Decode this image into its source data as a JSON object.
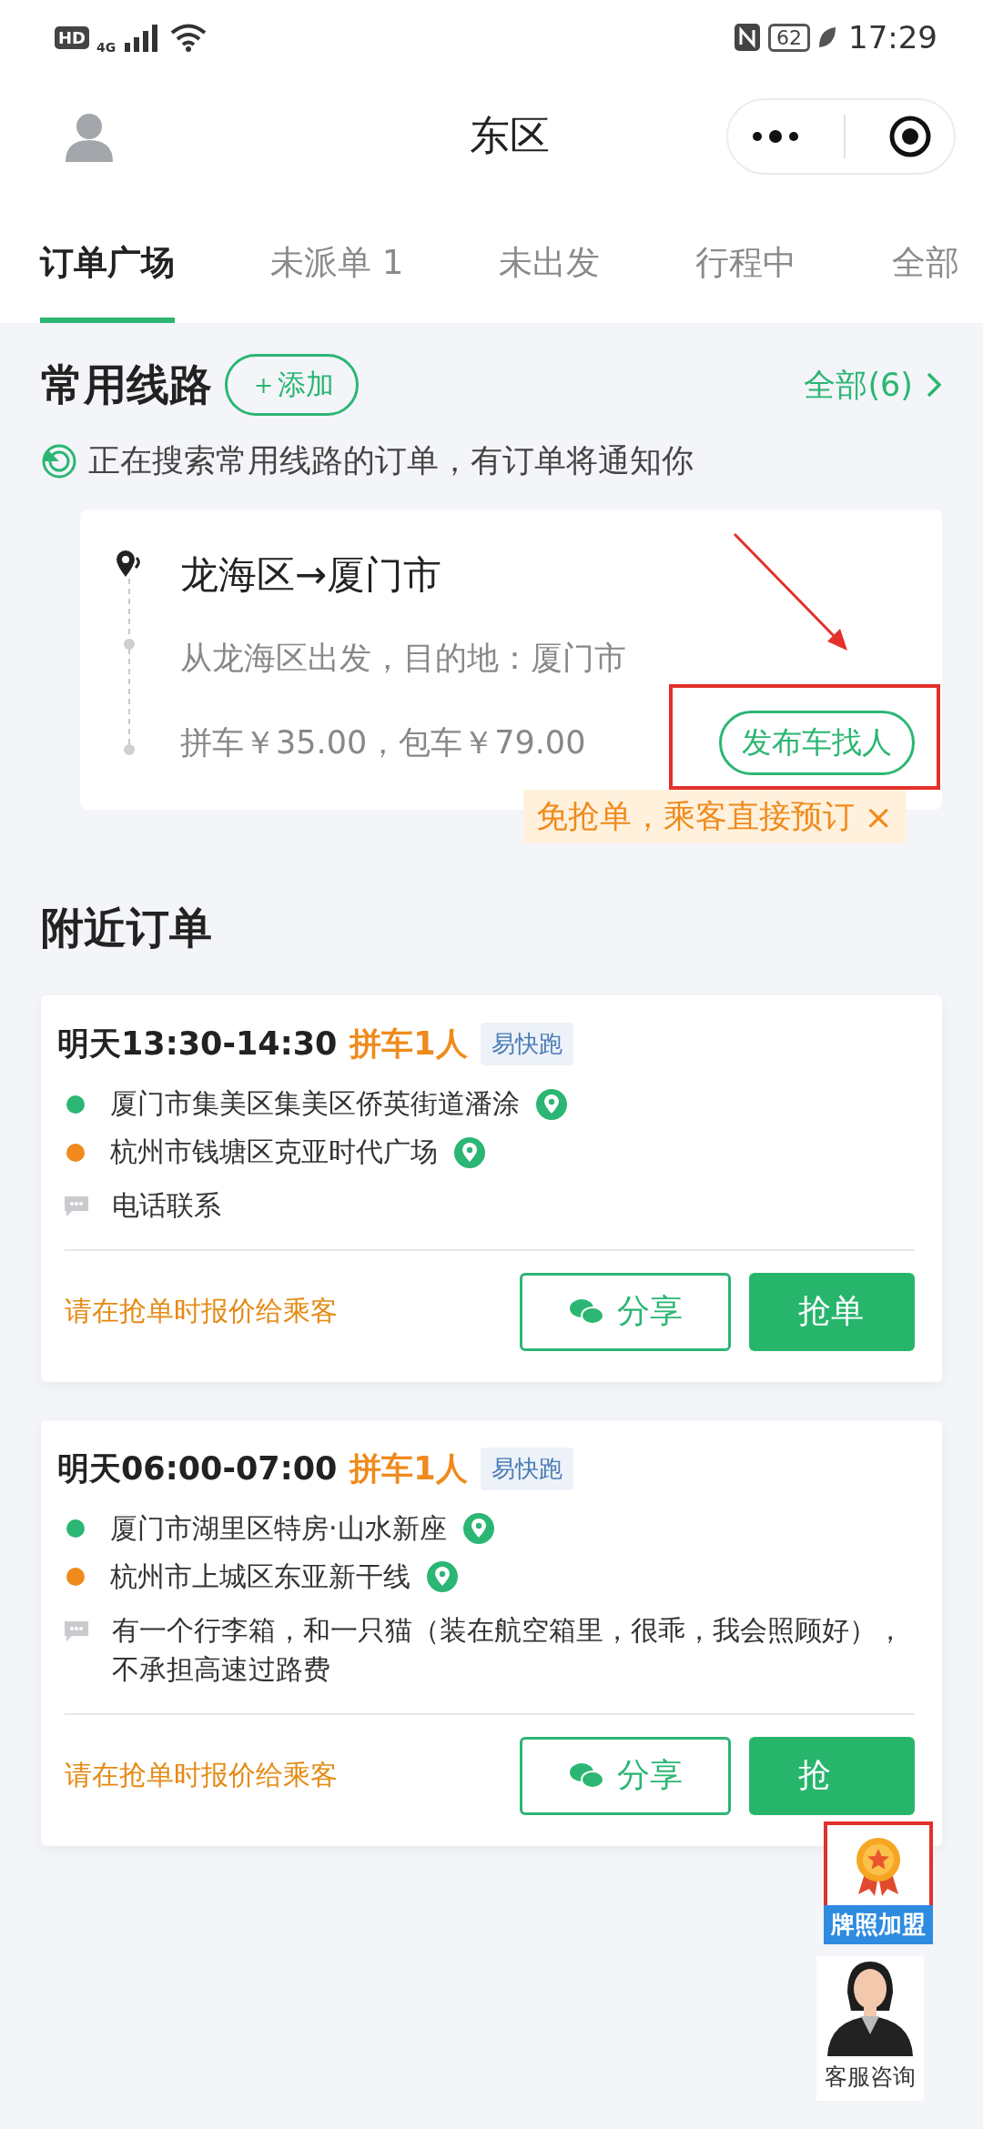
{
  "status_bar": {
    "hd": "HD",
    "network": "4G",
    "battery": "62",
    "time": "17:29"
  },
  "header": {
    "title": "东区"
  },
  "tabs": [
    {
      "label": "订单广场",
      "selected": true
    },
    {
      "label": "未派单 1",
      "selected": false
    },
    {
      "label": "未出发",
      "selected": false
    },
    {
      "label": "行程中",
      "selected": false
    },
    {
      "label": "全部",
      "selected": false
    }
  ],
  "routes_section": {
    "title": "常用线路",
    "add_button": "＋添加",
    "all_link": "全部(6)",
    "notice": "正在搜索常用线路的订单，有订单将通知你",
    "route": {
      "title": "龙海区→厦门市",
      "description": "从龙海区出发，目的地：厦门市",
      "prices": "拼车￥35.00，包车￥79.00",
      "publish_button": "发布车找人"
    },
    "tip": {
      "text": "免抢单，乘客直接预订",
      "close": "×"
    }
  },
  "nearby": {
    "title": "附近订单",
    "orders": [
      {
        "time": "明天13:30-14:30",
        "type": "拼车1人",
        "tag": "易快跑",
        "stops": [
          {
            "name": "厦门市集美区集美区侨英街道潘涂",
            "color": "#2bb673"
          },
          {
            "name": "杭州市钱塘区克亚时代广场",
            "color": "#f08a1c"
          }
        ],
        "note": "电话联系",
        "price_hint": "请在抢单时报价给乘客",
        "share_button": "分享",
        "grab_button": "抢单"
      },
      {
        "time": "明天06:00-07:00",
        "type": "拼车1人",
        "tag": "易快跑",
        "stops": [
          {
            "name": "厦门市湖里区特房·山水新座",
            "color": "#2bb673"
          },
          {
            "name": "杭州市上城区东亚新干线",
            "color": "#f08a1c"
          }
        ],
        "note": "有一个行李箱，和一只猫（装在航空箱里，很乖，我会照顾好），不承担高速过路费",
        "price_hint": "请在抢单时报价给乘客",
        "share_button": "分享",
        "grab_button": "抢"
      }
    ]
  },
  "float_badge": {
    "label": "牌照加盟"
  },
  "service": {
    "label": "客服咨询"
  }
}
